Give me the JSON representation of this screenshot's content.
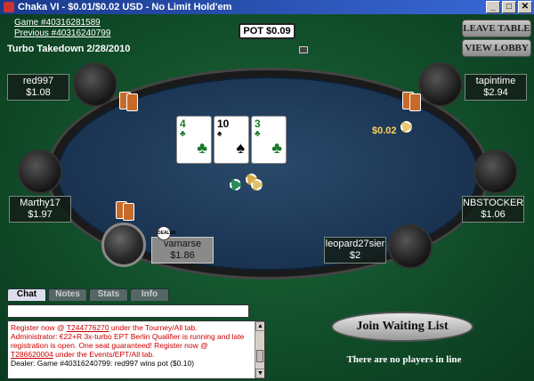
{
  "window": {
    "title": "Chaka VI - $0.01/$0.02 USD - No Limit Hold'em",
    "buttons": [
      "_",
      "□",
      "✕"
    ]
  },
  "info": {
    "game": "Game    #40316281589",
    "previous": "Previous #40316240799",
    "tournament": "Turbo Takedown 2/28/2010"
  },
  "side_buttons": {
    "leave": "LEAVE TABLE",
    "view_lobby": "VIEW LOBBY"
  },
  "pot": "POT $0.09",
  "board": [
    {
      "rank": "4",
      "suit": "♣",
      "color": "#1a7a2a"
    },
    {
      "rank": "10",
      "suit": "♠",
      "color": "#000000"
    },
    {
      "rank": "3",
      "suit": "♣",
      "color": "#1a7a2a"
    }
  ],
  "players": [
    {
      "name": "red997",
      "stack": "$1.08"
    },
    {
      "name": "tapintime",
      "stack": "$2.94"
    },
    {
      "name": "Marthy17",
      "stack": "$1.97"
    },
    {
      "name": "NBSTOCKER",
      "stack": "$1.06"
    },
    {
      "name": "vamarse",
      "stack": "$1.86"
    },
    {
      "name": "leopard27sier",
      "stack": "$2"
    }
  ],
  "bet": "$0.02",
  "dealer_label": "DEALER",
  "chat": {
    "tabs": [
      "Chat",
      "Notes",
      "Stats",
      "Info"
    ],
    "lines": [
      {
        "text": "Register now @ ",
        "link": "T244776270",
        "after": " under the Tourney/All tab."
      },
      {
        "text": "Administrator: €22+R 3x-turbo EPT Berlin Qualifier is running and late registration is open.  One seat guaranteed!  Register now @ ",
        "link": "T286620004",
        "after": " under the Events/EPT/All tab."
      },
      {
        "text": "Dealer: Game #40316240799: red997 wins pot ($0.10)"
      }
    ]
  },
  "join_button": "Join Waiting List",
  "waiting_status": "There are no players in line",
  "colors": {
    "felt": "#1d6a3a",
    "table": "#1c3655",
    "chat_red": "#cc0000"
  }
}
